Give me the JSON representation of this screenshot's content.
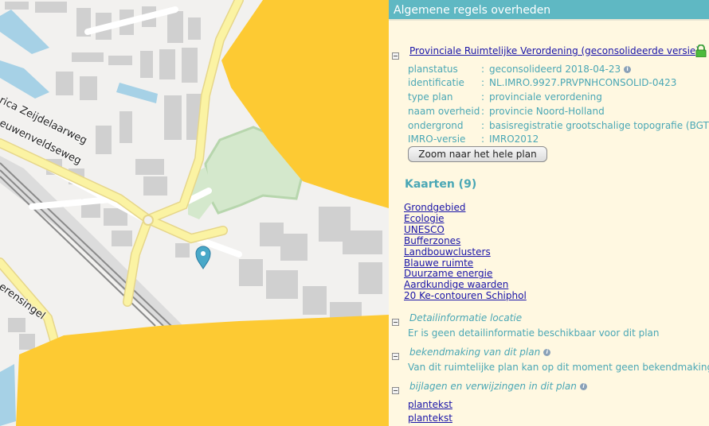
{
  "map": {
    "street_labels": [
      "rica Zeijdelaarweg",
      "euwenveldseweg",
      "erensingel"
    ],
    "marker_icon": "location-pin-icon",
    "colors": {
      "highlight": "#fdca33",
      "water": "#a6d1e6",
      "green": "#cde3c5",
      "road": "#fbf3a3",
      "building": "#d0d0d0"
    }
  },
  "panel": {
    "header": "Algemene regels overheden",
    "plan": {
      "title": "Provinciale Ruimtelijke Verordening (geconsolideerde versie)",
      "fields": [
        {
          "key": "planstatus",
          "value": "geconsolideerd 2018-04-23",
          "info": true
        },
        {
          "key": "identificatie",
          "value": "NL.IMRO.9927.PRVPNHCONSOLID-0423"
        },
        {
          "key": "type plan",
          "value": "provinciale verordening"
        },
        {
          "key": "naam overheid",
          "value": "provincie Noord-Holland"
        },
        {
          "key": "ondergrond",
          "value": "basisregistratie grootschalige topografie (BGT)"
        },
        {
          "key": "IMRO-versie",
          "value": "IMRO2012"
        }
      ],
      "zoom_button": "Zoom naar het hele plan"
    },
    "kaarten": {
      "title": "Kaarten (9)",
      "items": [
        "Grondgebied",
        "Ecologie",
        "UNESCO",
        "Bufferzones",
        "Landbouwclusters",
        "Blauwe ruimte",
        "Duurzame energie",
        "Aardkundige waarden",
        "20 Ke-contouren Schiphol"
      ]
    },
    "detail": {
      "title": "Detailinformatie locatie",
      "text": "Er is geen detailinformatie beschikbaar voor dit plan"
    },
    "bekendmaking": {
      "title": "bekendmaking van dit plan",
      "text": "Van dit ruimtelijke plan kan op dit moment geen bekendmaking"
    },
    "bijlagen": {
      "title": "bijlagen en verwijzingen in dit plan",
      "items": [
        "plantekst",
        "plantekst"
      ]
    }
  }
}
